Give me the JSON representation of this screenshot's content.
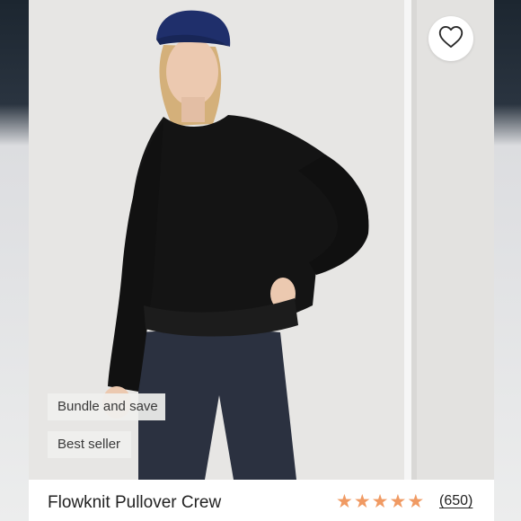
{
  "product": {
    "title": "Flowknit Pullover Crew",
    "rating_value": 5,
    "rating_max": 5,
    "review_count": "(650)",
    "badges": [
      "Bundle and save",
      "Best seller"
    ]
  },
  "icons": {
    "favorite": "heart-outline-icon",
    "star": "star-icon"
  },
  "colors": {
    "star": "#f09a63",
    "sweater": "#141414",
    "leggings": "#2b3140",
    "cap": "#1f2f6b",
    "background": "#e7e6e4"
  }
}
